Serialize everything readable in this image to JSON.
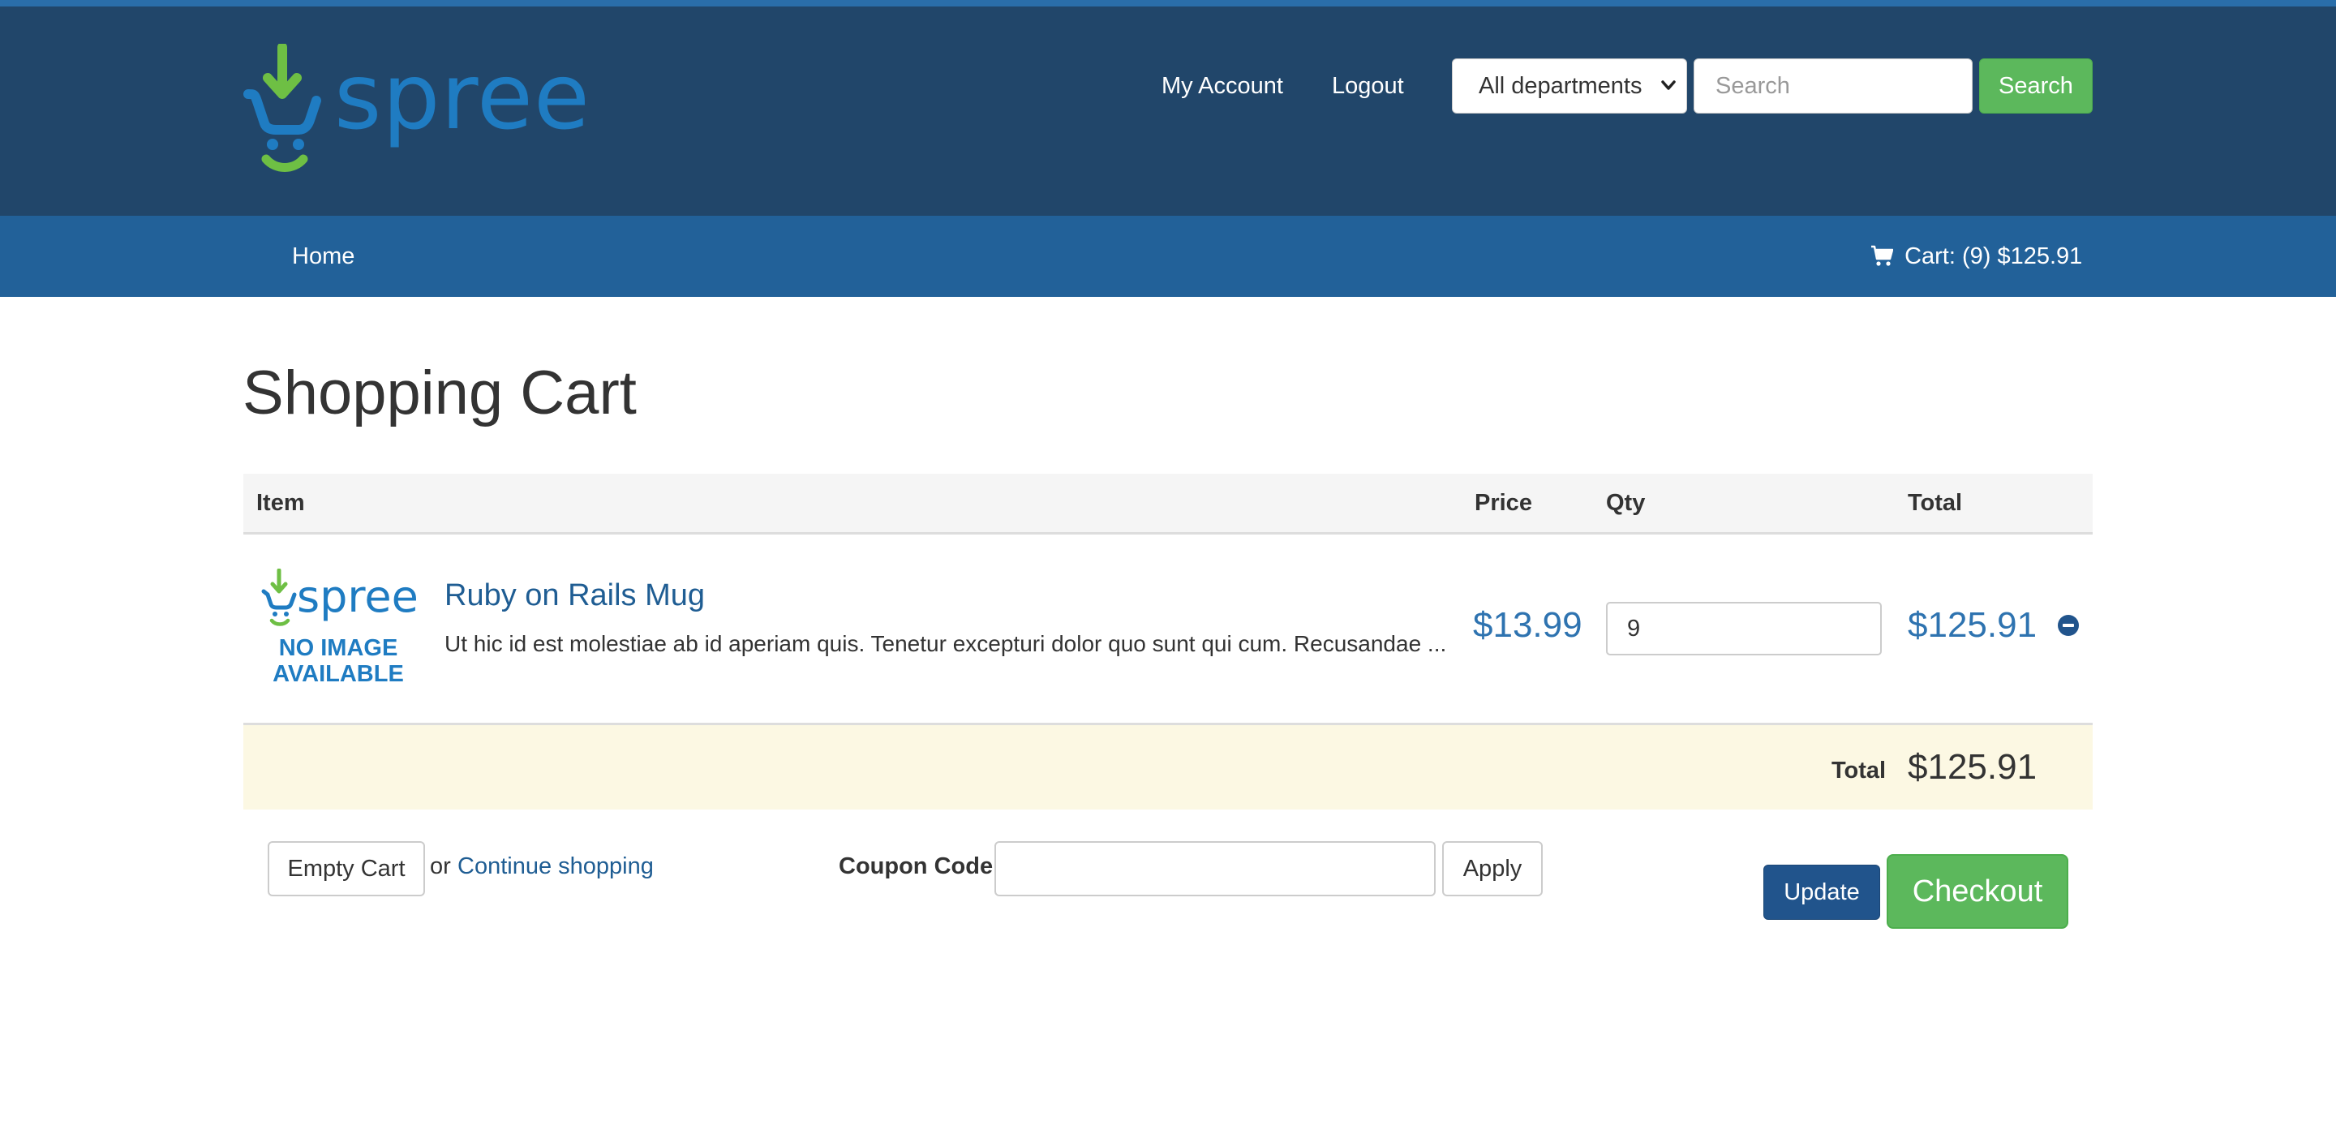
{
  "brand": {
    "logo_text": "spree",
    "colors": {
      "header": "#21466a",
      "navbar": "#226199",
      "logo_blue": "#1f7cc2",
      "logo_green": "#6ebf44",
      "success": "#5cb85c",
      "primary": "#21548c",
      "link": "#1f5d93"
    }
  },
  "header": {
    "my_account": "My Account",
    "logout": "Logout",
    "department": "All departments",
    "search_placeholder": "Search",
    "search_button": "Search"
  },
  "navbar": {
    "home": "Home",
    "cart_icon": "shopping-cart-icon",
    "cart": "Cart: (9) $125.91"
  },
  "main": {
    "title": "Shopping Cart",
    "columns": {
      "item": "Item",
      "price": "Price",
      "qty": "Qty",
      "total": "Total"
    },
    "line_items": [
      {
        "thumb_logo": "spree",
        "thumb_text": "NO IMAGE AVAILABLE",
        "name": "Ruby on Rails Mug",
        "description": "Ut hic id est molestiae ab id aperiam quis. Tenetur excepturi dolor quo sunt qui cum. Recusandae ...",
        "price": "$13.99",
        "quantity": "9",
        "total": "$125.91",
        "remove_icon": "minus-circle-icon"
      }
    ],
    "order_total_label": "Total",
    "order_total": "$125.91"
  },
  "actions": {
    "empty_cart": "Empty Cart",
    "or": "or",
    "continue_shopping": "Continue shopping",
    "coupon_label": "Coupon Code",
    "coupon_value": "",
    "apply": "Apply",
    "update": "Update",
    "checkout": "Checkout"
  }
}
